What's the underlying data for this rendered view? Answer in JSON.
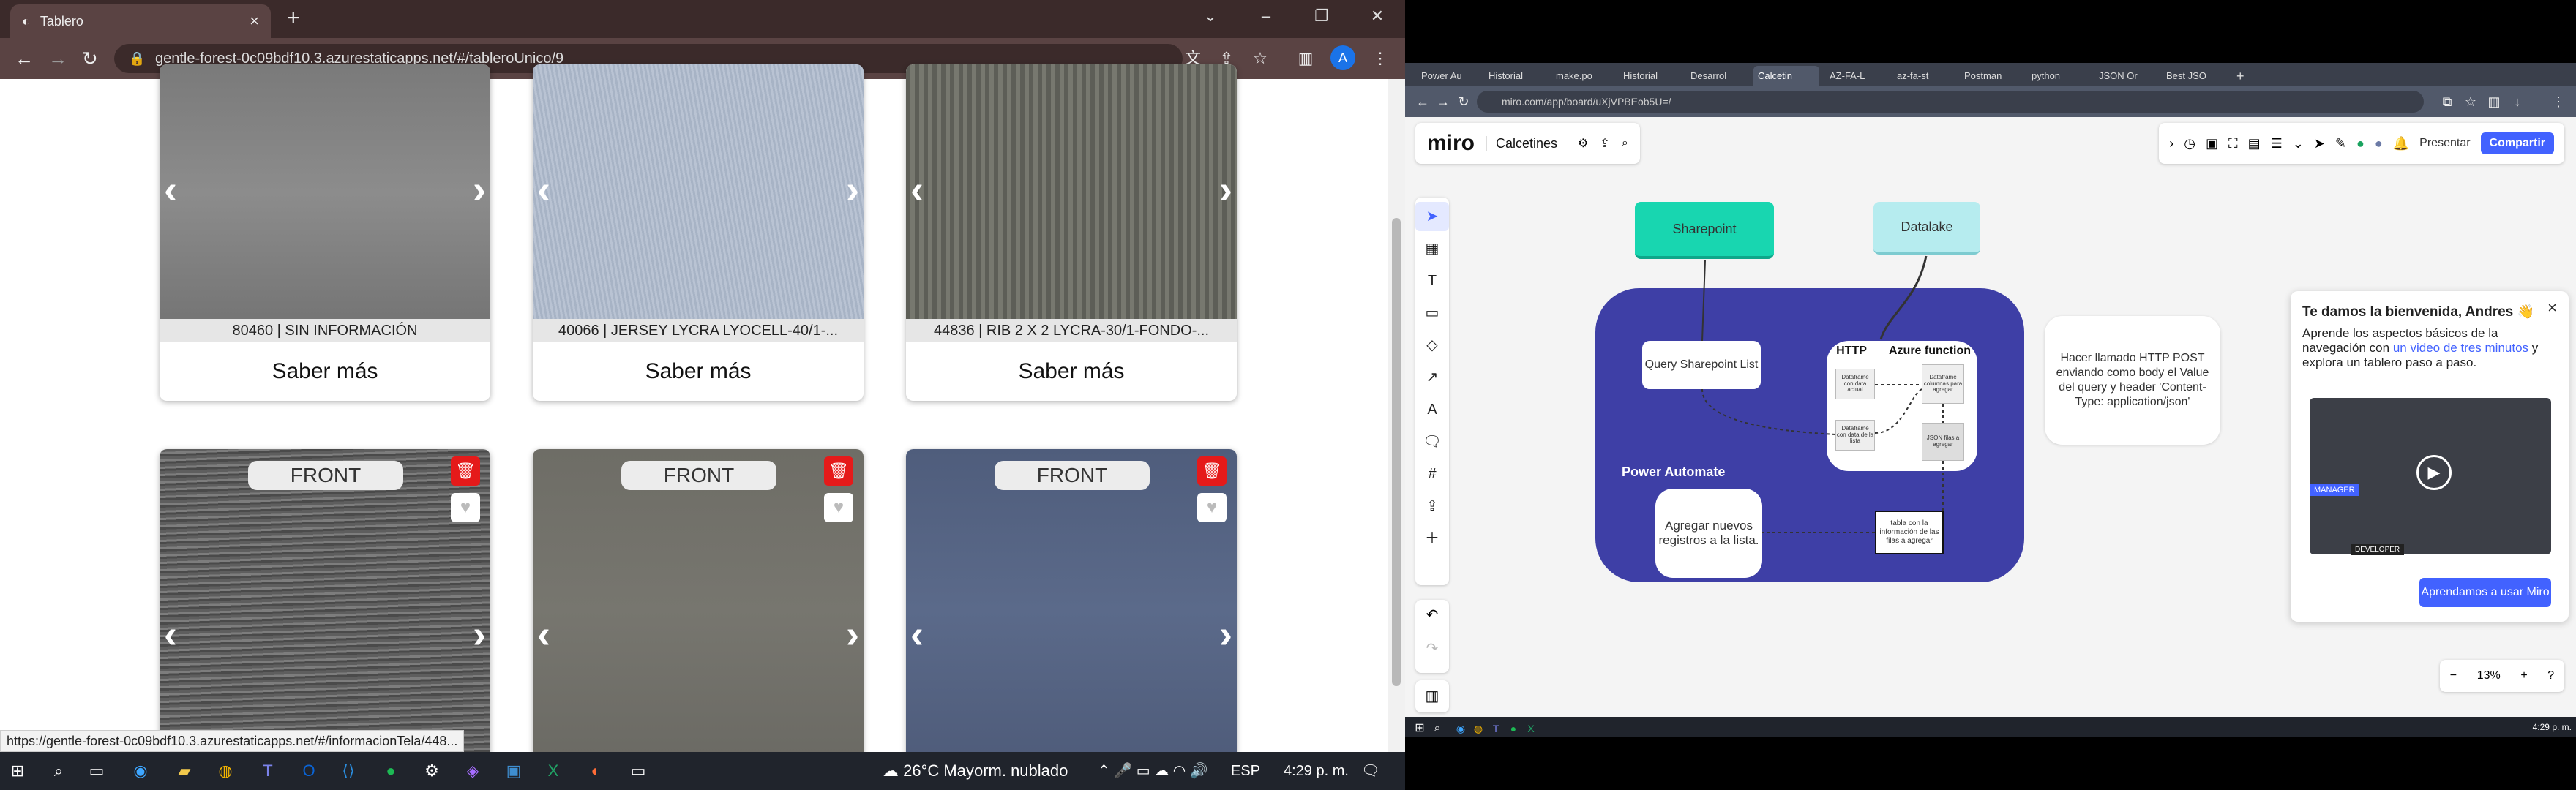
{
  "left": {
    "tab_title": "Tablero",
    "url": "gentle-forest-0c09bdf10.3.azurestaticapps.net/#/tableroUnico/9",
    "status_url": "https://gentle-forest-0c09bdf10.3.azurestaticapps.net/#/informacionTela/448...",
    "avatar": "A",
    "cards_top": [
      {
        "caption": "80460 | SIN INFORMACIÓN",
        "button": "Saber más"
      },
      {
        "caption": "40066 | JERSEY LYCRA LYOCELL-40/1-...",
        "button": "Saber más"
      },
      {
        "caption": "44836 | RIB 2 X 2 LYCRA-30/1-FONDO-...",
        "button": "Saber más"
      }
    ],
    "cards_bottom": [
      {
        "label": "FRONT"
      },
      {
        "label": "FRONT"
      },
      {
        "label": "FRONT"
      }
    ],
    "taskbar": {
      "weather": "26°C  Mayorm. nublado",
      "lang": "ESP",
      "time": "4:29 p. m."
    }
  },
  "right": {
    "tabs": [
      "Power Au",
      "Historial",
      "make.po",
      "Historial",
      "Desarrol",
      "Calcetin",
      "AZ-FA-L",
      "az-fa-st",
      "Postman",
      "python",
      "JSON Or",
      "Best JSO"
    ],
    "url": "miro.com/app/board/uXjVPBEob5U=/",
    "board_title": "Calcetines",
    "logo": "miro",
    "present": "Presentar",
    "share": "Compartir",
    "nodes": {
      "sharepoint": "Sharepoint",
      "datalake": "Datalake",
      "query": "Query Sharepoint List",
      "http": "HTTP",
      "azure": "Azure function",
      "power_automate": "Power Automate",
      "agregar": "Agregar nuevos registros a la lista.",
      "tabla": "tabla con la información de las filas a agregar",
      "df1": "Dataframe con data actual",
      "df2": "Dataframe con data de la lista",
      "df3": "Dataframe columnas para agregar",
      "json": "JSON filas a agregar"
    },
    "note": "Hacer llamado HTTP POST enviando como body el Value del query y header 'Content-Type: application/json'",
    "onboarding": {
      "title": "Te damos la bienvenida, Andres 👋",
      "text1": "Aprende los aspectos básicos de la navegación con",
      "link": "un video de tres minutos",
      "text2": "y explora un tablero paso a paso.",
      "button": "Aprendamos a usar Miro",
      "video_labels": [
        "MANAGER",
        "DEVELOPER"
      ]
    },
    "zoom": "13%",
    "clock": "4:29 p. m."
  }
}
